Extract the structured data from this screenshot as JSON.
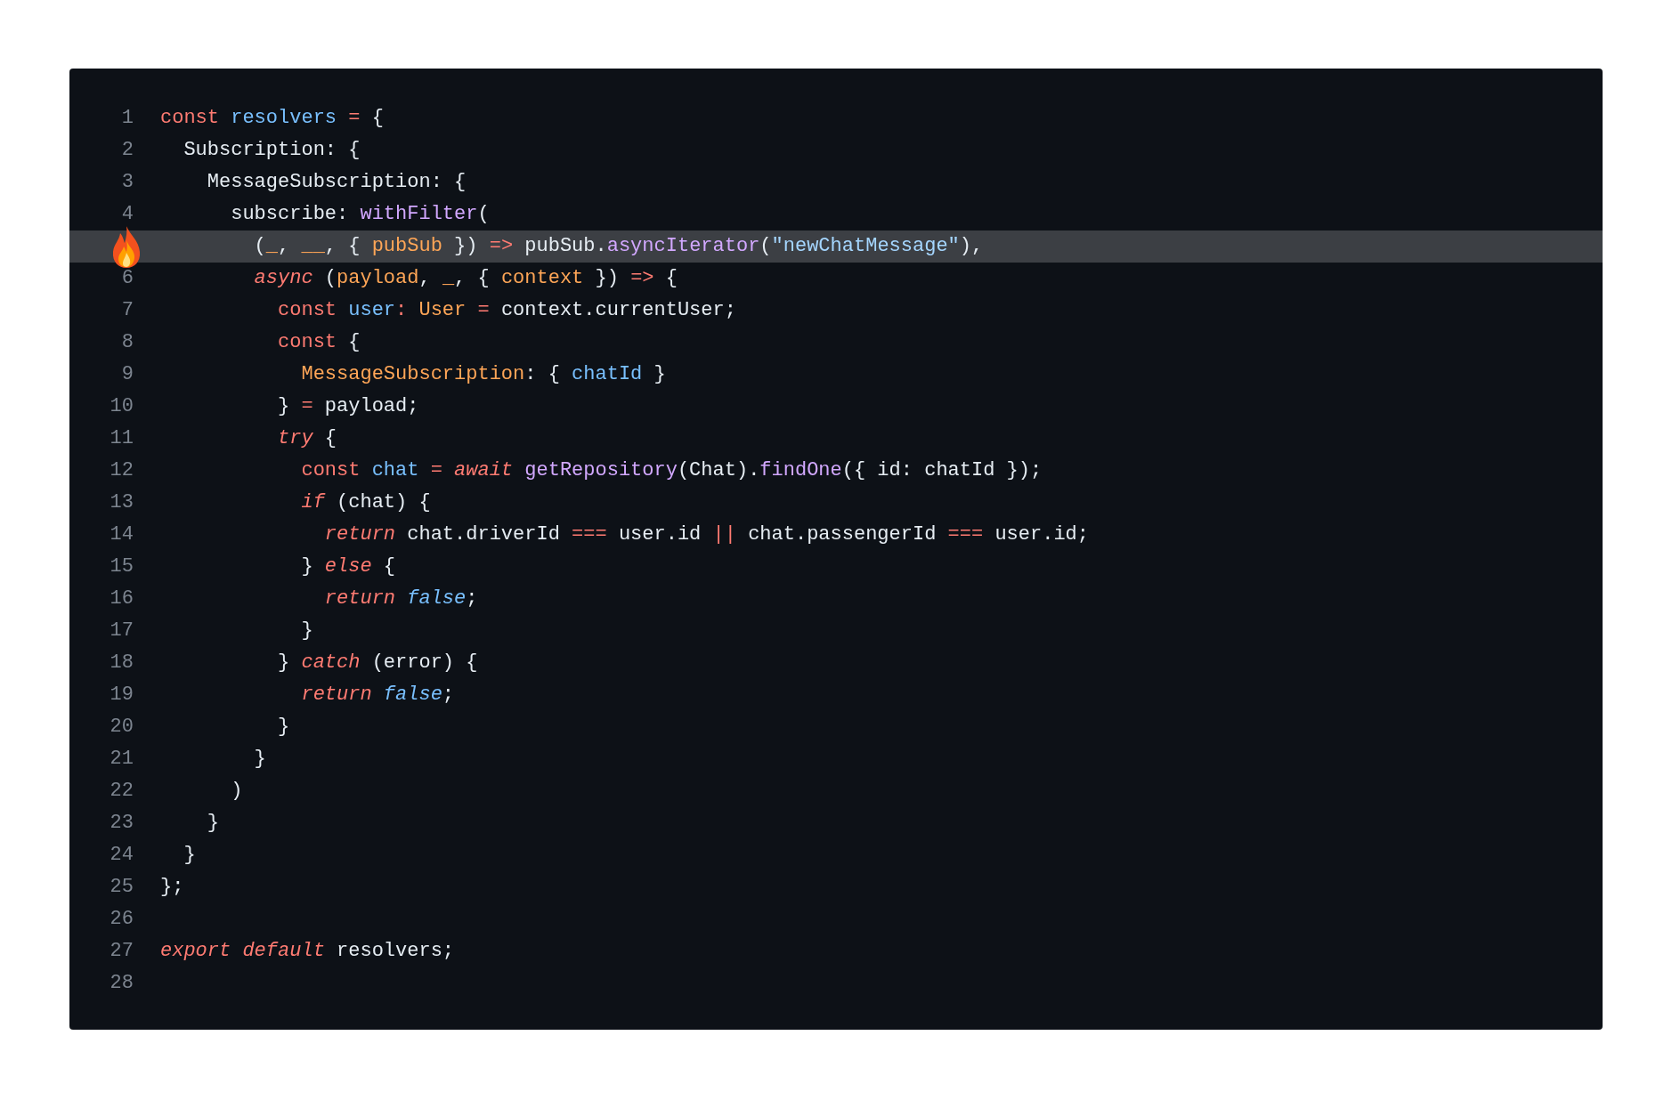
{
  "editor": {
    "lines": [
      {
        "number": "1",
        "highlighted": false,
        "tokens": [
          {
            "kind": "keyword",
            "text": "const "
          },
          {
            "kind": "variable",
            "text": "resolvers "
          },
          {
            "kind": "operator",
            "text": "= "
          },
          {
            "kind": "plain",
            "text": "{"
          }
        ]
      },
      {
        "number": "2",
        "highlighted": false,
        "tokens": [
          {
            "kind": "plain",
            "text": "  Subscription: {"
          }
        ]
      },
      {
        "number": "3",
        "highlighted": false,
        "tokens": [
          {
            "kind": "plain",
            "text": "    MessageSubscription: {"
          }
        ]
      },
      {
        "number": "4",
        "highlighted": false,
        "tokens": [
          {
            "kind": "plain",
            "text": "      subscribe: "
          },
          {
            "kind": "function",
            "text": "withFilter"
          },
          {
            "kind": "plain",
            "text": "("
          }
        ]
      },
      {
        "highlighted": true,
        "tokens": [
          {
            "kind": "plain",
            "text": "        ("
          },
          {
            "kind": "param",
            "text": "_"
          },
          {
            "kind": "plain",
            "text": ", "
          },
          {
            "kind": "param",
            "text": "__"
          },
          {
            "kind": "plain",
            "text": ", { "
          },
          {
            "kind": "param",
            "text": "pubSub"
          },
          {
            "kind": "plain",
            "text": " }) "
          },
          {
            "kind": "operator",
            "text": "=>"
          },
          {
            "kind": "plain",
            "text": " pubSub."
          },
          {
            "kind": "function",
            "text": "asyncIterator"
          },
          {
            "kind": "plain",
            "text": "("
          },
          {
            "kind": "string",
            "text": "\"newChatMessage\""
          },
          {
            "kind": "plain",
            "text": "),"
          }
        ]
      },
      {
        "number": "6",
        "highlighted": false,
        "tokens": [
          {
            "kind": "keyword_italic",
            "text": "        async"
          },
          {
            "kind": "plain",
            "text": " ("
          },
          {
            "kind": "param",
            "text": "payload"
          },
          {
            "kind": "plain",
            "text": ", "
          },
          {
            "kind": "param",
            "text": "_"
          },
          {
            "kind": "plain",
            "text": ", { "
          },
          {
            "kind": "param",
            "text": "context"
          },
          {
            "kind": "plain",
            "text": " }) "
          },
          {
            "kind": "operator",
            "text": "=>"
          },
          {
            "kind": "plain",
            "text": " {"
          }
        ]
      },
      {
        "number": "7",
        "highlighted": false,
        "tokens": [
          {
            "kind": "keyword",
            "text": "          const "
          },
          {
            "kind": "variable",
            "text": "user"
          },
          {
            "kind": "operator",
            "text": ": "
          },
          {
            "kind": "param",
            "text": "User "
          },
          {
            "kind": "operator",
            "text": "= "
          },
          {
            "kind": "plain",
            "text": "context.currentUser;"
          }
        ]
      },
      {
        "number": "8",
        "highlighted": false,
        "tokens": [
          {
            "kind": "keyword",
            "text": "          const "
          },
          {
            "kind": "plain",
            "text": "{"
          }
        ]
      },
      {
        "number": "9",
        "highlighted": false,
        "tokens": [
          {
            "kind": "param",
            "text": "            MessageSubscription"
          },
          {
            "kind": "plain",
            "text": ": { "
          },
          {
            "kind": "variable",
            "text": "chatId"
          },
          {
            "kind": "plain",
            "text": " }"
          }
        ]
      },
      {
        "number": "10",
        "highlighted": false,
        "tokens": [
          {
            "kind": "plain",
            "text": "          } "
          },
          {
            "kind": "operator",
            "text": "="
          },
          {
            "kind": "plain",
            "text": " payload;"
          }
        ]
      },
      {
        "number": "11",
        "highlighted": false,
        "tokens": [
          {
            "kind": "keyword_italic",
            "text": "          try"
          },
          {
            "kind": "plain",
            "text": " {"
          }
        ]
      },
      {
        "number": "12",
        "highlighted": false,
        "tokens": [
          {
            "kind": "keyword",
            "text": "            const "
          },
          {
            "kind": "variable",
            "text": "chat "
          },
          {
            "kind": "operator",
            "text": "= "
          },
          {
            "kind": "keyword_italic",
            "text": "await "
          },
          {
            "kind": "function",
            "text": "getRepository"
          },
          {
            "kind": "plain",
            "text": "(Chat)."
          },
          {
            "kind": "function",
            "text": "findOne"
          },
          {
            "kind": "plain",
            "text": "({ id: chatId });"
          }
        ]
      },
      {
        "number": "13",
        "highlighted": false,
        "tokens": [
          {
            "kind": "keyword_italic",
            "text": "            if"
          },
          {
            "kind": "plain",
            "text": " (chat) {"
          }
        ]
      },
      {
        "number": "14",
        "highlighted": false,
        "tokens": [
          {
            "kind": "keyword_italic",
            "text": "              return"
          },
          {
            "kind": "plain",
            "text": " chat.driverId "
          },
          {
            "kind": "operator",
            "text": "==="
          },
          {
            "kind": "plain",
            "text": " user.id "
          },
          {
            "kind": "operator",
            "text": "||"
          },
          {
            "kind": "plain",
            "text": " chat.passengerId "
          },
          {
            "kind": "operator",
            "text": "==="
          },
          {
            "kind": "plain",
            "text": " user.id;"
          }
        ]
      },
      {
        "number": "15",
        "highlighted": false,
        "tokens": [
          {
            "kind": "plain",
            "text": "            } "
          },
          {
            "kind": "keyword_italic",
            "text": "else"
          },
          {
            "kind": "plain",
            "text": " {"
          }
        ]
      },
      {
        "number": "16",
        "highlighted": false,
        "tokens": [
          {
            "kind": "keyword_italic",
            "text": "              return "
          },
          {
            "kind": "boolean",
            "text": "false"
          },
          {
            "kind": "plain",
            "text": ";"
          }
        ]
      },
      {
        "number": "17",
        "highlighted": false,
        "tokens": [
          {
            "kind": "plain",
            "text": "            }"
          }
        ]
      },
      {
        "number": "18",
        "highlighted": false,
        "tokens": [
          {
            "kind": "plain",
            "text": "          } "
          },
          {
            "kind": "keyword_italic",
            "text": "catch"
          },
          {
            "kind": "plain",
            "text": " (error) {"
          }
        ]
      },
      {
        "number": "19",
        "highlighted": false,
        "tokens": [
          {
            "kind": "keyword_italic",
            "text": "            return "
          },
          {
            "kind": "boolean",
            "text": "false"
          },
          {
            "kind": "plain",
            "text": ";"
          }
        ]
      },
      {
        "number": "20",
        "highlighted": false,
        "tokens": [
          {
            "kind": "plain",
            "text": "          }"
          }
        ]
      },
      {
        "number": "21",
        "highlighted": false,
        "tokens": [
          {
            "kind": "plain",
            "text": "        }"
          }
        ]
      },
      {
        "number": "22",
        "highlighted": false,
        "tokens": [
          {
            "kind": "plain",
            "text": "      )"
          }
        ]
      },
      {
        "number": "23",
        "highlighted": false,
        "tokens": [
          {
            "kind": "plain",
            "text": "    }"
          }
        ]
      },
      {
        "number": "24",
        "highlighted": false,
        "tokens": [
          {
            "kind": "plain",
            "text": "  }"
          }
        ]
      },
      {
        "number": "25",
        "highlighted": false,
        "tokens": [
          {
            "kind": "plain",
            "text": "};"
          }
        ]
      },
      {
        "number": "26",
        "highlighted": false
      },
      {
        "number": "27",
        "highlighted": false,
        "tokens": [
          {
            "kind": "keyword_italic",
            "text": "export default "
          },
          {
            "kind": "plain",
            "text": "resolvers;"
          }
        ]
      },
      {
        "number": "28",
        "highlighted": false
      }
    ]
  }
}
